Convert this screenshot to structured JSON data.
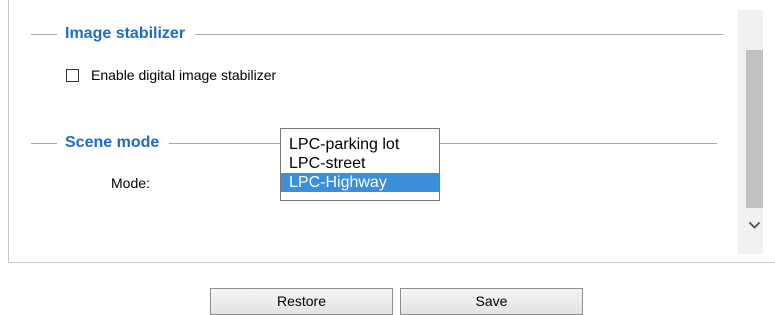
{
  "image_stabilizer": {
    "title": "Image stabilizer",
    "checkbox_label": "Enable digital image stabilizer",
    "checked": false
  },
  "scene_mode": {
    "title": "Scene mode",
    "mode_label": "Mode:",
    "options": [
      "LPC-parking lot",
      "LPC-street",
      "LPC-Highway"
    ],
    "selected": "LPC-Highway"
  },
  "buttons": {
    "restore": "Restore",
    "save": "Save"
  },
  "scrollbar": {
    "down_arrow_icon": "chevron-down-icon"
  },
  "colors": {
    "section_title": "#1f6cc4",
    "selection": "#3a8fd8"
  }
}
